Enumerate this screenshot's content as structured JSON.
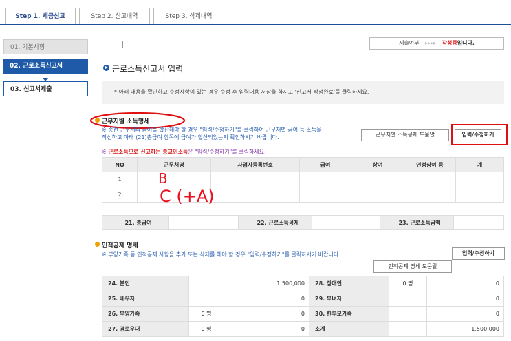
{
  "tabs": [
    {
      "label": "Step 1. 세금신고"
    },
    {
      "label": "Step 2. 신고내역"
    },
    {
      "label": "Step 3. 삭제내역"
    }
  ],
  "sidebar": {
    "items": [
      {
        "label": "01. 기본사항"
      },
      {
        "label": "02. 근로소득신고서"
      },
      {
        "label": "03. 신고서제출"
      }
    ]
  },
  "status": {
    "label": "제출여부",
    "arrows": "▸▸▸▸",
    "value_red": "작성중",
    "value_suffix": "입니다."
  },
  "main": {
    "heading": "근로소득신고서 입력",
    "notice": "* 아래 내용을 확인하고 수정사항이 있는 경우 수정 후 입력내용 저장을 하시고 '신고서 작성완료'를 클릭하세요."
  },
  "workplace": {
    "title": "근무지별 소득명세",
    "desc_line1": "※ 종전 근무지의 급여를 합산해야 할 경우 \"입력/수정하기\"를 클릭하여 근무처별 급여 등 소득을",
    "desc_line2": "작성하고 아래 (21)총급여 항목에 급여가 합산되었는지 확인하시기 바랍니다.",
    "help_button": "근무처별 소득공제 도움말",
    "edit_button": "입력/수정하기",
    "religious_prefix": "※ ",
    "religious_red": "근로소득으로 신고하는 종교인소득",
    "religious_suffix": "은 \"입력/수정하기\"를 클릭하세요.",
    "columns": [
      "NO",
      "근무처명",
      "사업자등록번호",
      "급여",
      "상여",
      "인정상여 등",
      "계"
    ],
    "rows": [
      {
        "no": "1",
        "cells": [
          "",
          "",
          "",
          "",
          "",
          ""
        ]
      },
      {
        "no": "2",
        "cells": [
          "",
          "",
          "",
          "",
          "",
          ""
        ]
      }
    ],
    "summary": [
      {
        "label": "21. 총급여",
        "value": ""
      },
      {
        "label": "22. 근로소득공제",
        "value": ""
      },
      {
        "label": "23. 근로소득금액",
        "value": ""
      }
    ]
  },
  "handwriting": {
    "b": "B",
    "c": "C (+A)"
  },
  "personal": {
    "title": "인적공제 명세",
    "desc": "※ 부양가족 등 인적공제 사항을 추가 또는 삭제를 해야 할 경우 \"입력/수정하기\"를 클릭하시기 바랍니다.",
    "edit_button": "입력/수정하기",
    "help_button": "인적공제 명세 도움말",
    "rows": [
      {
        "l_label": "24. 본인",
        "l_count": "",
        "l_value": "1,500,000",
        "r_label": "28. 장애인",
        "r_count": "0 명",
        "r_value": "0"
      },
      {
        "l_label": "25. 배우자",
        "l_count": "",
        "l_value": "0",
        "r_label": "29. 부녀자",
        "r_count": "",
        "r_value": "0"
      },
      {
        "l_label": "26. 부양가족",
        "l_count": "0 명",
        "l_value": "0",
        "r_label": "30. 한부모가족",
        "r_count": "",
        "r_value": "0"
      },
      {
        "l_label": "27. 경로우대",
        "l_count": "0 명",
        "l_value": "0",
        "r_label": "소계",
        "r_count": "",
        "r_value": "1,500,000"
      }
    ]
  },
  "colors": {
    "brand_blue": "#1f5aa8",
    "annotation_red": "#e01010",
    "accent_orange": "#f0a000"
  }
}
